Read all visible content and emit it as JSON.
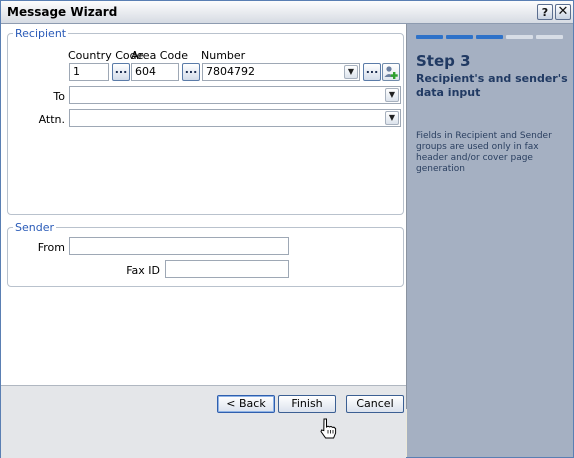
{
  "window": {
    "title": "Message Wizard",
    "help_label": "?",
    "close_label": "✕"
  },
  "recipient": {
    "group_title": "Recipient",
    "country_code_label": "Country Code",
    "area_code_label": "Area Code",
    "number_label": "Number",
    "country_code_value": "1",
    "area_code_value": "604",
    "number_value": "7804792",
    "browse_label": "...",
    "to_label": "To",
    "to_value": "",
    "attn_label": "Attn.",
    "attn_value": ""
  },
  "sender": {
    "group_title": "Sender",
    "from_label": "From",
    "from_value": "",
    "fax_id_label": "Fax ID",
    "fax_id_value": ""
  },
  "footer": {
    "back_label": "< Back",
    "finish_label": "Finish",
    "cancel_label": "Cancel"
  },
  "side": {
    "progress_steps_total": 5,
    "progress_steps_done": 3,
    "step_title": "Step 3",
    "step_subtitle": "Recipient's and sender's data input",
    "step_description": "Fields in Recipient and Sender groups are used only in fax header and/or cover page generation"
  },
  "colors": {
    "accent": "#2e72c9",
    "side_panel": "#a5b0c2",
    "group_title": "#2a5bb8"
  },
  "icons": {
    "combo_arrow": "chevron-down-icon",
    "add_contact": "add-contact-icon",
    "cursor": "hand-pointer-icon"
  }
}
